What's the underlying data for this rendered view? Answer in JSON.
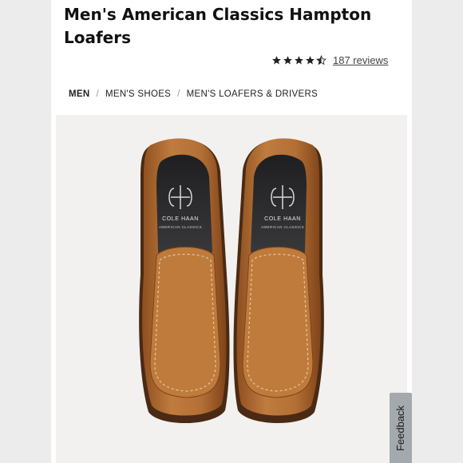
{
  "product": {
    "title": "Men's American Classics Hampton Loafers",
    "rating": 4.5,
    "reviews_label": "187 reviews"
  },
  "breadcrumb": [
    "MEN",
    "MEN'S SHOES",
    "MEN'S LOAFERS & DRIVERS"
  ],
  "image": {
    "brand_line1": "COLE HAAN",
    "brand_line2": "AMERICAN CLASSICS"
  },
  "feedback": {
    "label": "Feedback"
  },
  "colors": {
    "leather": "#b5733a",
    "leather_dark": "#8a4f22",
    "insole": "#2b2b2d",
    "star": "#222222"
  }
}
